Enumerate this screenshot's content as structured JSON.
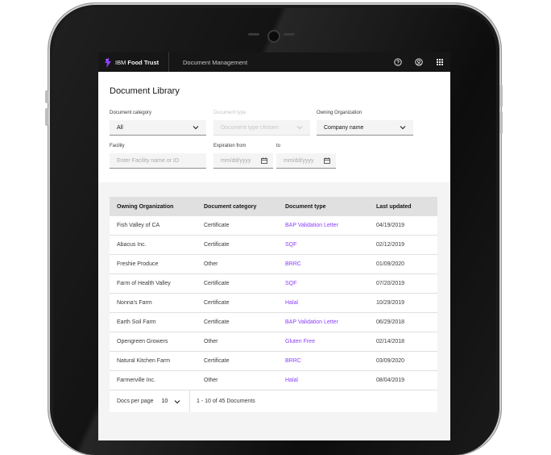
{
  "device": {
    "sensor_label": "Sensor"
  },
  "topbar": {
    "brand_prefix": "IBM ",
    "brand_name": "Food Trust",
    "product": "Document Management",
    "icons": [
      "help-icon",
      "user-icon",
      "app-switcher-icon"
    ]
  },
  "page": {
    "title": "Document Library"
  },
  "filters": {
    "doc_category": {
      "label": "Document category",
      "value": "All"
    },
    "doc_type": {
      "label": "Document type",
      "placeholder": "Document type chosen"
    },
    "owning_org": {
      "label": "Owning Organization",
      "value": "Company name"
    },
    "facility": {
      "label": "Facility",
      "placeholder": "Enter Facility name or ID"
    },
    "expiration_from": {
      "label": "Expiration from",
      "placeholder": "mm/dd/yyyy"
    },
    "expiration_to": {
      "label": "to",
      "placeholder": "mm/dd/yyyy"
    }
  },
  "table": {
    "headers": [
      "Owning Organization",
      "Document category",
      "Document type",
      "Last updated"
    ],
    "rows": [
      [
        "Fish Valley of CA",
        "Certificate",
        "BAP Validation Letter",
        "04/19/2019"
      ],
      [
        "Abacus Inc.",
        "Certificate",
        "SQF",
        "02/12/2019"
      ],
      [
        "Freshie Produce",
        "Other",
        "BRRC",
        "01/09/2020"
      ],
      [
        "Farm of Health Valley",
        "Certificate",
        "SQF",
        "07/20/2019"
      ],
      [
        "Nonna's Farm",
        "Certificate",
        "Halal",
        "10/29/2019"
      ],
      [
        "Earth Soil Farm",
        "Certificate",
        "BAP Validation Letter",
        "06/29/2018"
      ],
      [
        "Opengreen Growers",
        "Other",
        "Gluten Free",
        "02/14/2018"
      ],
      [
        "Natural Kitchen Farm",
        "Certificate",
        "BRRC",
        "03/09/2020"
      ],
      [
        "Farmerville Inc.",
        "Other",
        "Halal",
        "08/04/2019"
      ]
    ]
  },
  "pagination": {
    "per_page_label": "Docs per page",
    "per_page_value": "10",
    "range": "1 - 10 of 45 Documents"
  },
  "colors": {
    "link": "#8a3ffc",
    "topbar": "#161616"
  }
}
